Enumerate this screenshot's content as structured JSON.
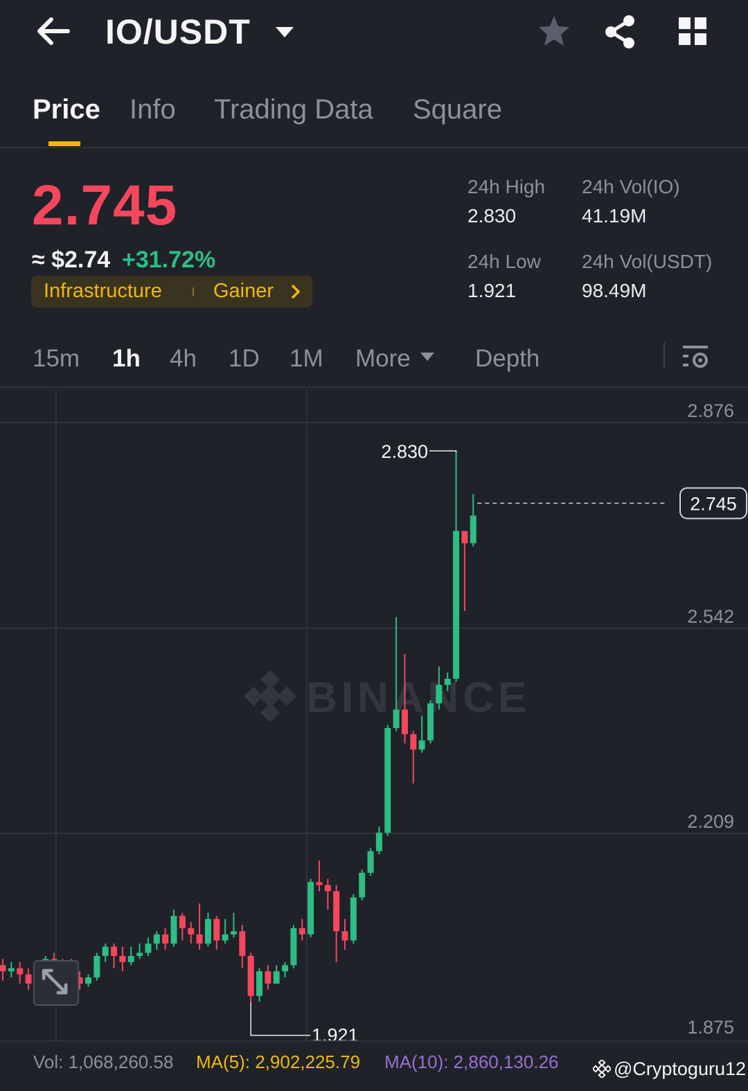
{
  "header": {
    "pair": "IO/USDT",
    "icons": [
      "back-arrow-icon",
      "caret-down-icon",
      "star-icon",
      "share-icon",
      "grid-icon"
    ]
  },
  "tabs": [
    {
      "label": "Price",
      "active": true
    },
    {
      "label": "Info",
      "active": false
    },
    {
      "label": "Trading Data",
      "active": false
    },
    {
      "label": "Square",
      "active": false
    }
  ],
  "ticker": {
    "last_price": "2.745",
    "usd_price": "≈ $2.74",
    "change": "+31.72%",
    "tags": [
      "Infrastructure",
      "Gainer"
    ]
  },
  "stats": {
    "high_label": "24h High",
    "high_value": "2.830",
    "low_label": "24h Low",
    "low_value": "1.921",
    "vol_io_label": "24h Vol(IO)",
    "vol_io_value": "41.19M",
    "vol_usdt_label": "24h Vol(USDT)",
    "vol_usdt_value": "98.49M"
  },
  "intervals": [
    {
      "label": "15m",
      "active": false
    },
    {
      "label": "1h",
      "active": true
    },
    {
      "label": "4h",
      "active": false
    },
    {
      "label": "1D",
      "active": false
    },
    {
      "label": "1M",
      "active": false
    },
    {
      "label": "More",
      "active": false
    },
    {
      "label": "Depth",
      "active": false
    }
  ],
  "colors": {
    "up": "#2ebd85",
    "down": "#f6465d",
    "accent": "#f0b90b",
    "ma10": "#9a6fd3",
    "background": "#1f2229"
  },
  "chart_data": {
    "type": "candlestick",
    "y_ticks": [
      "2.876",
      "2.542",
      "2.209",
      "1.875"
    ],
    "y_tick_values": [
      2.876,
      2.542,
      2.209,
      1.875
    ],
    "ylim": [
      1.875,
      2.876
    ],
    "current_price": "2.745",
    "high_marker": "2.830",
    "low_marker": "1.921",
    "watermark": "BINANCE",
    "candles": [
      [
        1.995,
        1.985,
        2.005,
        1.97
      ],
      [
        1.985,
        1.99,
        2.0,
        1.975
      ],
      [
        1.99,
        1.98,
        2.0,
        1.965
      ],
      [
        1.98,
        1.965,
        1.99,
        1.955
      ],
      [
        1.965,
        1.975,
        1.98,
        1.955
      ],
      [
        1.975,
        2.005,
        2.01,
        1.97
      ],
      [
        2.005,
        1.995,
        2.015,
        1.985
      ],
      [
        1.995,
        1.985,
        2.005,
        1.975
      ],
      [
        1.985,
        1.975,
        2.005,
        1.965
      ],
      [
        1.975,
        1.965,
        1.985,
        1.955
      ],
      [
        1.965,
        1.975,
        1.98,
        1.96
      ],
      [
        1.975,
        2.01,
        2.015,
        1.97
      ],
      [
        2.01,
        2.025,
        2.03,
        2.0
      ],
      [
        2.025,
        2.01,
        2.03,
        1.99
      ],
      [
        2.01,
        2.0,
        2.025,
        1.985
      ],
      [
        2.0,
        2.01,
        2.025,
        1.995
      ],
      [
        2.01,
        2.015,
        2.03,
        2.005
      ],
      [
        2.015,
        2.03,
        2.04,
        2.01
      ],
      [
        2.03,
        2.045,
        2.05,
        2.02
      ],
      [
        2.045,
        2.03,
        2.055,
        2.02
      ],
      [
        2.03,
        2.075,
        2.085,
        2.025
      ],
      [
        2.075,
        2.055,
        2.08,
        2.035
      ],
      [
        2.055,
        2.045,
        2.065,
        2.03
      ],
      [
        2.045,
        2.03,
        2.095,
        2.02
      ],
      [
        2.03,
        2.07,
        2.08,
        2.025
      ],
      [
        2.07,
        2.035,
        2.075,
        2.02
      ],
      [
        2.035,
        2.045,
        2.07,
        2.03
      ],
      [
        2.045,
        2.05,
        2.08,
        2.04
      ],
      [
        2.05,
        2.01,
        2.06,
        1.99
      ],
      [
        2.01,
        1.945,
        2.015,
        1.935
      ],
      [
        1.945,
        1.985,
        1.99,
        1.936
      ],
      [
        1.985,
        1.965,
        1.995,
        1.955
      ],
      [
        1.965,
        1.985,
        1.995,
        1.965
      ],
      [
        1.985,
        1.995,
        2.0,
        1.975
      ],
      [
        1.995,
        2.055,
        2.06,
        1.99
      ],
      [
        2.055,
        2.045,
        2.07,
        2.035
      ],
      [
        2.045,
        2.13,
        2.135,
        2.04
      ],
      [
        2.13,
        2.125,
        2.165,
        2.115
      ],
      [
        2.125,
        2.115,
        2.135,
        2.085
      ],
      [
        2.115,
        2.05,
        2.125,
        2.0
      ],
      [
        2.05,
        2.035,
        2.07,
        2.02
      ],
      [
        2.035,
        2.105,
        2.11,
        2.03
      ],
      [
        2.105,
        2.145,
        2.15,
        2.1
      ],
      [
        2.145,
        2.18,
        2.185,
        2.14
      ],
      [
        2.18,
        2.21,
        2.22,
        2.175
      ],
      [
        2.21,
        2.38,
        2.385,
        2.205
      ],
      [
        2.38,
        2.41,
        2.56,
        2.375
      ],
      [
        2.41,
        2.37,
        2.5,
        2.355
      ],
      [
        2.37,
        2.345,
        2.375,
        2.29
      ],
      [
        2.345,
        2.36,
        2.4,
        2.34
      ],
      [
        2.36,
        2.42,
        2.425,
        2.355
      ],
      [
        2.42,
        2.45,
        2.48,
        2.41
      ],
      [
        2.45,
        2.46,
        2.47,
        2.44
      ],
      [
        2.46,
        2.7,
        2.83,
        2.455
      ],
      [
        2.7,
        2.68,
        2.7,
        2.57
      ],
      [
        2.68,
        2.725,
        2.76,
        2.675
      ]
    ]
  },
  "volume_bar": {
    "vol": "Vol: 1,068,260.58",
    "ma5": "MA(5): 2,902,225.79",
    "ma10": "MA(10): 2,860,130.26"
  },
  "credit": "@Cryptoguru12"
}
